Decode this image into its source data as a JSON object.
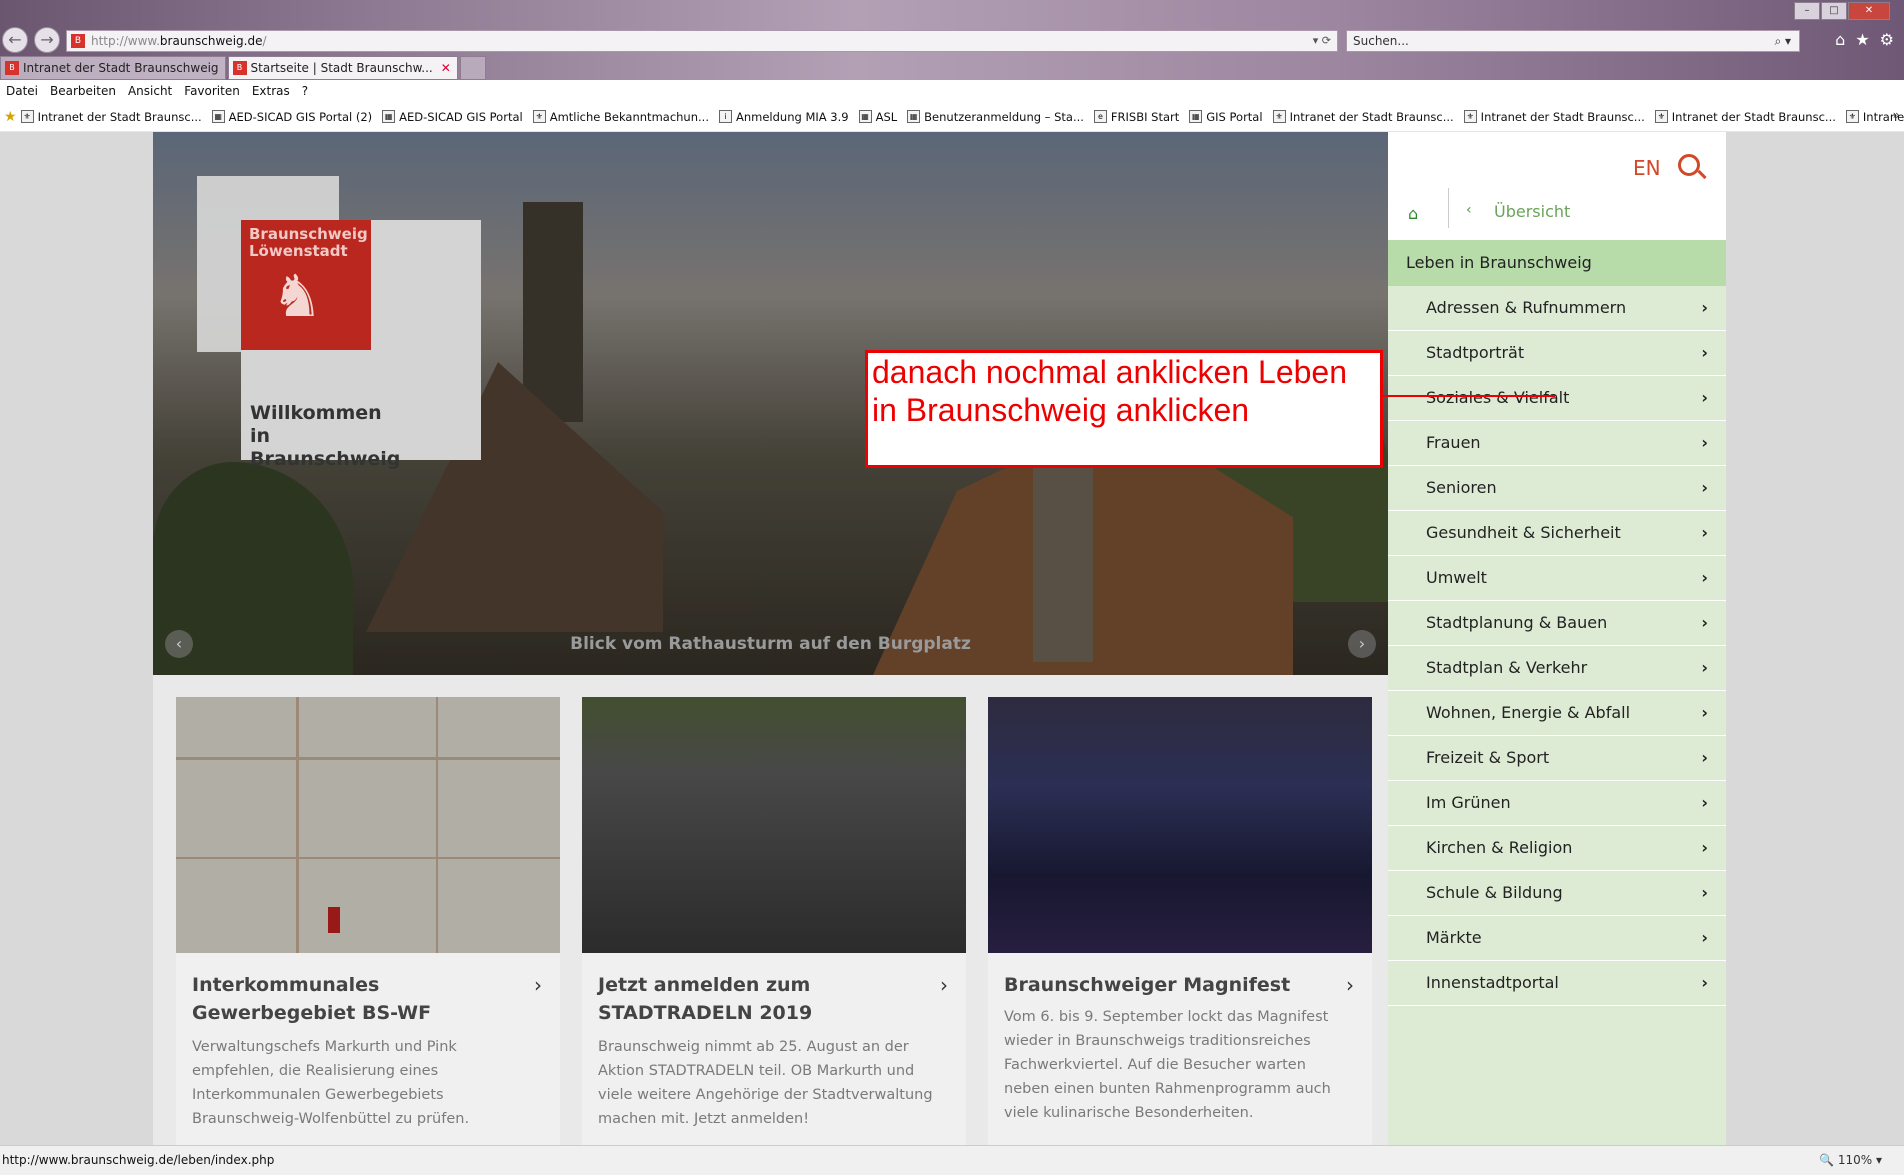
{
  "browser": {
    "address_prefix": "http://www.",
    "address_domain": "braunschweig.de",
    "address_suffix": "/",
    "search_placeholder": "Suchen...",
    "tabs": [
      {
        "label": "Intranet der Stadt Braunschweig"
      },
      {
        "label": "Startseite | Stadt Braunschw..."
      }
    ],
    "menu": [
      "Datei",
      "Bearbeiten",
      "Ansicht",
      "Favoriten",
      "Extras",
      "?"
    ],
    "favorites": [
      "Intranet der Stadt Braunsc...",
      "AED-SICAD GIS Portal (2)",
      "AED-SICAD GIS Portal",
      "Amtliche Bekanntmachun...",
      "Anmeldung MIA 3.9",
      "ASL",
      "Benutzeranmeldung – Sta...",
      "FRISBI Start",
      "GIS Portal",
      "Intranet der Stadt Braunsc...",
      "Intranet der Stadt Braunsc...",
      "Intranet der Stadt Braunsc...",
      "Intranet der Stadt Braunsc..."
    ],
    "status_url": "http://www.braunschweig.de/leben/index.php",
    "zoom": "110%"
  },
  "hero": {
    "logo_text": "Braunschweig Löwenstadt",
    "welcome": "Willkommen in Braunschweig",
    "caption": "Blick vom Rathausturm auf den Burgplatz"
  },
  "annotation": {
    "text": "danach nochmal anklicken Leben in Braunschweig anklicken"
  },
  "teasers": [
    {
      "title": "Interkommunales Gewerbegebiet BS-WF",
      "text": "Verwaltungschefs Markurth und Pink empfehlen, die Realisierung eines Interkommunalen Gewerbegebiets Braunschweig-Wolfenbüttel zu prüfen."
    },
    {
      "title": "Jetzt anmelden zum STADTRADELN 2019",
      "text": "Braunschweig nimmt ab 25. August an der Aktion STADTRADELN teil. OB Markurth und viele weitere Angehörige der Stadtverwaltung machen mit. Jetzt anmelden!"
    },
    {
      "title": "Braunschweiger Magnifest",
      "text": "Vom 6. bis 9. September lockt das Magnifest wieder in Braunschweigs traditionsreiches Fachwerkviertel. Auf die Besucher warten neben einen bunten Rahmenprogramm auch viele kulinarische Besonderheiten."
    }
  ],
  "nav": {
    "lang": "EN",
    "overview": "Übersicht",
    "active": "Leben in Braunschweig",
    "items": [
      "Adressen & Rufnummern",
      "Stadtporträt",
      "Soziales & Vielfalt",
      "Frauen",
      "Senioren",
      "Gesundheit & Sicherheit",
      "Umwelt",
      "Stadtplanung & Bauen",
      "Stadtplan & Verkehr",
      "Wohnen, Energie & Abfall",
      "Freizeit & Sport",
      "Im Grünen",
      "Kirchen & Religion",
      "Schule & Bildung",
      "Märkte",
      "Innenstadtportal"
    ]
  }
}
